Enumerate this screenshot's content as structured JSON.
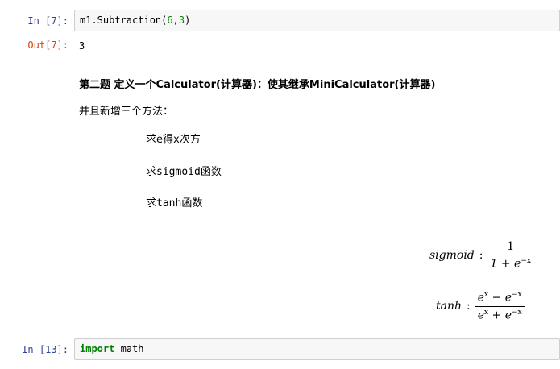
{
  "cells": [
    {
      "prompt": "In  [7]:",
      "code_prefix": "m1.Subtraction(",
      "code_arg1": "6",
      "code_comma": ",",
      "code_arg2": "3",
      "code_suffix": ")"
    },
    {
      "prompt": "In  [13]:",
      "code_keyword": "import",
      "code_rest": " math"
    }
  ],
  "output": {
    "prompt": "Out[7]:",
    "value": "3"
  },
  "markdown": {
    "heading": "第二题 定义一个Calculator(计算器)：使其继承MiniCalculator(计算器)",
    "intro": "并且新增三个方法：",
    "method1_a": "求e得",
    "method1_b": "x",
    "method1_c": "次方",
    "method2_a": "求",
    "method2_b": "sigmoid",
    "method2_c": "函数",
    "method3_a": "求",
    "method3_b": "tanh",
    "method3_c": "函数"
  },
  "formulas": {
    "sigmoid_name": "sigmoid",
    "sigmoid_num": "1",
    "sigmoid_den_a": "1 + e",
    "sigmoid_den_exp": "−x",
    "tanh_name": "tanh",
    "tanh_num_e1": "e",
    "tanh_num_x1": "x",
    "tanh_num_op": " − e",
    "tanh_num_x2": "−x",
    "tanh_den_e1": "e",
    "tanh_den_x1": "x",
    "tanh_den_op": " + e",
    "tanh_den_x2": "−x",
    "colon": ":"
  }
}
